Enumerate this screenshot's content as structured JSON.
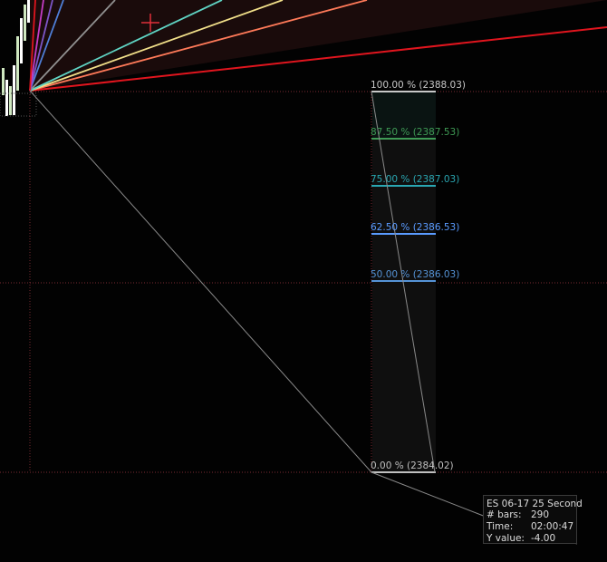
{
  "fib_levels": [
    {
      "label": "100.00 % (2388.03)",
      "color": "#c8c8c8"
    },
    {
      "label": "87.50 % (2387.53)",
      "color": "#3f9b55"
    },
    {
      "label": "75.00 % (2387.03)",
      "color": "#2aa7b2"
    },
    {
      "label": "62.50 % (2386.53)",
      "color": "#5a9bff"
    },
    {
      "label": "50.00 % (2386.03)",
      "color": "#5593d6"
    },
    {
      "label": "0.00 % (2384.02)",
      "color": "#bfbfbf"
    }
  ],
  "gann_fan_colors": [
    "#e0151e",
    "#ff7a59",
    "#f2e08a",
    "#5fd3c3",
    "#909090",
    "#4f7fd8",
    "#7c56c6",
    "#c43cc4",
    "#e0151e"
  ],
  "crosshair_color": "#e0303a",
  "data_box": {
    "title": "ES 06-17 25 Second",
    "rows": [
      {
        "key": "# bars:",
        "value": "290"
      },
      {
        "key": "Time:",
        "value": "02:00:47"
      },
      {
        "key": "Y value:",
        "value": "-4.00"
      }
    ]
  }
}
